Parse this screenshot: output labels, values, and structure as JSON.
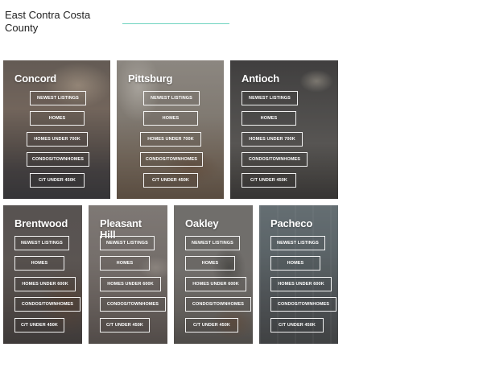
{
  "page": {
    "title": "East Contra Costa County"
  },
  "colors": {
    "accent_rule": "#6fd3c0",
    "button_border": "#ffffff",
    "text_on_photo": "#ffffff"
  },
  "cards": [
    {
      "city": "Concord",
      "links": [
        "NEWEST LISTINGS",
        "HOMES",
        "HOMES UNDER 700K",
        "CONDOS/TOWNHOMES",
        "C/T UNDER 450K"
      ]
    },
    {
      "city": "Pittsburg",
      "links": [
        "NEWEST LISTINGS",
        "HOMES",
        "HOMES UNDER 700K",
        "CONDOS/TOWNHOMES",
        "C/T UNDER 450K"
      ]
    },
    {
      "city": "Antioch",
      "links": [
        "NEWEST LISTINGS",
        "HOMES",
        "HOMES UNDER 700K",
        "CONDOS/TOWNHOMES",
        "C/T UNDER 450K"
      ]
    },
    {
      "city": "Brentwood",
      "links": [
        "NEWEST LISTINGS",
        "HOMES",
        "HOMES UNDER 600K",
        "CONDOS/TOWNHOMES",
        "C/T UNDER 450K"
      ]
    },
    {
      "city": "Pleasant Hill",
      "links": [
        "NEWEST LISTINGS",
        "HOMES",
        "HOMES UNDER 600K",
        "CONDOS/TOWNHOMES",
        "C/T UNDER 450K"
      ]
    },
    {
      "city": "Oakley",
      "links": [
        "NEWEST LISTINGS",
        "HOMES",
        "HOMES UNDER 600K",
        "CONDOS/TOWNHOMES",
        "C/T UNDER 450K"
      ]
    },
    {
      "city": "Pacheco",
      "links": [
        "NEWEST LISTINGS",
        "HOMES",
        "HOMES UNDER 600K",
        "CONDOS/TOWNHOMES",
        "C/T UNDER 450K"
      ]
    }
  ]
}
